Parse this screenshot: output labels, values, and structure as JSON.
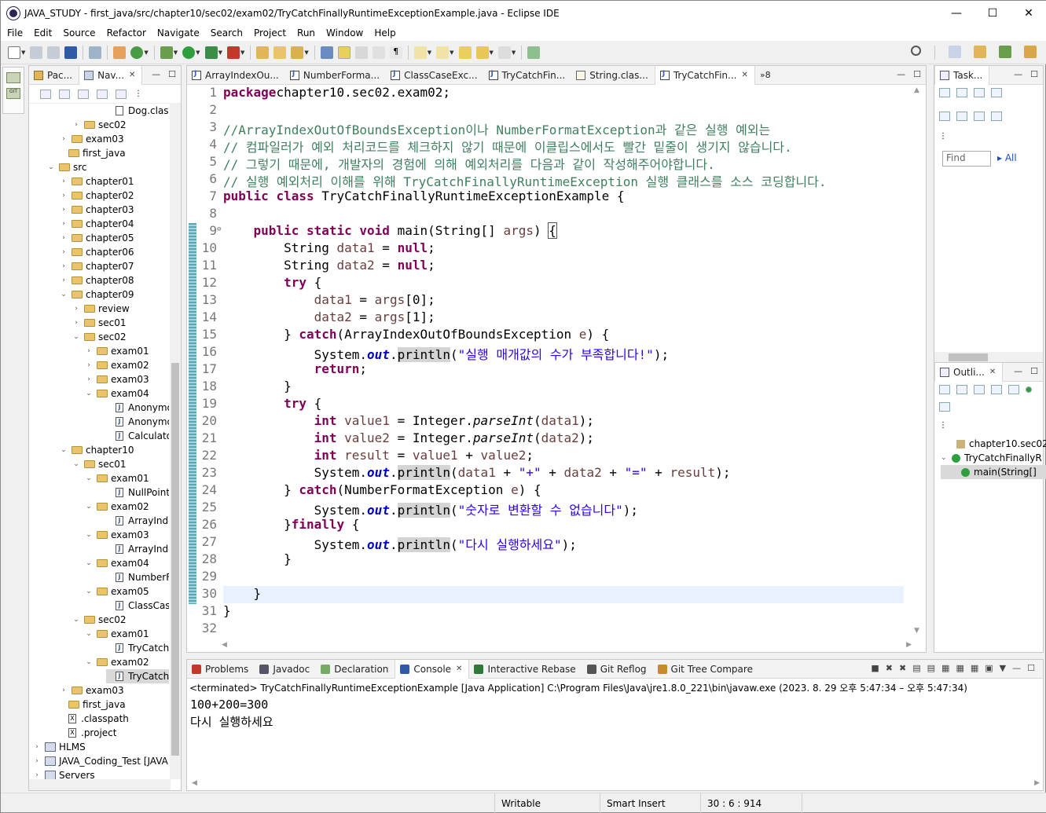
{
  "window": {
    "title": "JAVA_STUDY - first_java/src/chapter10/sec02/exam02/TryCatchFinallyRuntimeExceptionExample.java - Eclipse IDE",
    "controls": [
      "—",
      "☐",
      "✕"
    ]
  },
  "menu": [
    "File",
    "Edit",
    "Source",
    "Refactor",
    "Navigate",
    "Search",
    "Project",
    "Run",
    "Window",
    "Help"
  ],
  "explorer": {
    "tabs": [
      {
        "label": "Pac..."
      },
      {
        "label": "Nav..."
      }
    ],
    "items": [
      {
        "label": "Dog.class",
        "kind": "class",
        "depth": 6,
        "arrow": ""
      },
      {
        "label": "sec02",
        "kind": "folder",
        "depth": 3,
        "arrow": "›"
      },
      {
        "label": "exam03",
        "kind": "folder",
        "depth": 2,
        "arrow": "›"
      },
      {
        "label": "first_java",
        "kind": "folder",
        "depth": 2,
        "arrow": ""
      },
      {
        "label": "src",
        "kind": "folder",
        "depth": 1,
        "arrow": "⌄"
      },
      {
        "label": "chapter01",
        "kind": "folder",
        "depth": 2,
        "arrow": "›"
      },
      {
        "label": "chapter02",
        "kind": "folder",
        "depth": 2,
        "arrow": "›"
      },
      {
        "label": "chapter03",
        "kind": "folder",
        "depth": 2,
        "arrow": "›"
      },
      {
        "label": "chapter04",
        "kind": "folder",
        "depth": 2,
        "arrow": "›"
      },
      {
        "label": "chapter05",
        "kind": "folder",
        "depth": 2,
        "arrow": "›"
      },
      {
        "label": "chapter06",
        "kind": "folder",
        "depth": 2,
        "arrow": "›"
      },
      {
        "label": "chapter07",
        "kind": "folder",
        "depth": 2,
        "arrow": "›"
      },
      {
        "label": "chapter08",
        "kind": "folder",
        "depth": 2,
        "arrow": "›"
      },
      {
        "label": "chapter09",
        "kind": "folder",
        "depth": 2,
        "arrow": "⌄"
      },
      {
        "label": "review",
        "kind": "folder",
        "depth": 3,
        "arrow": "›"
      },
      {
        "label": "sec01",
        "kind": "folder",
        "depth": 3,
        "arrow": "›"
      },
      {
        "label": "sec02",
        "kind": "folder",
        "depth": 3,
        "arrow": "⌄"
      },
      {
        "label": "exam01",
        "kind": "folder",
        "depth": 4,
        "arrow": "›"
      },
      {
        "label": "exam02",
        "kind": "folder",
        "depth": 4,
        "arrow": "›"
      },
      {
        "label": "exam03",
        "kind": "folder",
        "depth": 4,
        "arrow": "›"
      },
      {
        "label": "exam04",
        "kind": "folder",
        "depth": 4,
        "arrow": "⌄"
      },
      {
        "label": "Anonymo",
        "kind": "java",
        "depth": 6,
        "arrow": ""
      },
      {
        "label": "Anonymo",
        "kind": "java",
        "depth": 6,
        "arrow": ""
      },
      {
        "label": "Calculator",
        "kind": "java",
        "depth": 6,
        "arrow": ""
      },
      {
        "label": "chapter10",
        "kind": "folder",
        "depth": 2,
        "arrow": "⌄"
      },
      {
        "label": "sec01",
        "kind": "folder",
        "depth": 3,
        "arrow": "⌄"
      },
      {
        "label": "exam01",
        "kind": "folder",
        "depth": 4,
        "arrow": "⌄"
      },
      {
        "label": "NullPointe",
        "kind": "java",
        "depth": 6,
        "arrow": ""
      },
      {
        "label": "exam02",
        "kind": "folder",
        "depth": 4,
        "arrow": "⌄"
      },
      {
        "label": "ArrayIndex",
        "kind": "java",
        "depth": 6,
        "arrow": ""
      },
      {
        "label": "exam03",
        "kind": "folder",
        "depth": 4,
        "arrow": "⌄"
      },
      {
        "label": "ArrayIndex",
        "kind": "java",
        "depth": 6,
        "arrow": ""
      },
      {
        "label": "exam04",
        "kind": "folder",
        "depth": 4,
        "arrow": "⌄"
      },
      {
        "label": "NumberFo",
        "kind": "java",
        "depth": 6,
        "arrow": ""
      },
      {
        "label": "exam05",
        "kind": "folder",
        "depth": 4,
        "arrow": "⌄"
      },
      {
        "label": "ClassCaseE",
        "kind": "java",
        "depth": 6,
        "arrow": ""
      },
      {
        "label": "sec02",
        "kind": "folder",
        "depth": 3,
        "arrow": "⌄"
      },
      {
        "label": "exam01",
        "kind": "folder",
        "depth": 4,
        "arrow": "⌄"
      },
      {
        "label": "TryCatchF",
        "kind": "java",
        "depth": 6,
        "arrow": ""
      },
      {
        "label": "exam02",
        "kind": "folder",
        "depth": 4,
        "arrow": "⌄"
      },
      {
        "label": "TryCatchF",
        "kind": "java",
        "depth": 6,
        "arrow": "",
        "selected": true
      },
      {
        "label": "exam03",
        "kind": "folder",
        "depth": 2,
        "arrow": "›"
      },
      {
        "label": "first_java",
        "kind": "folder",
        "depth": 2,
        "arrow": ""
      },
      {
        "label": ".classpath",
        "kind": "xml",
        "depth": 2,
        "arrow": ""
      },
      {
        "label": ".project",
        "kind": "xml",
        "depth": 2,
        "arrow": ""
      },
      {
        "label": "HLMS",
        "kind": "project",
        "depth": 0,
        "arrow": "›"
      },
      {
        "label": "JAVA_Coding_Test [JAVA",
        "kind": "project",
        "depth": 0,
        "arrow": "›"
      },
      {
        "label": "Servers",
        "kind": "project",
        "depth": 0,
        "arrow": "›"
      }
    ]
  },
  "editor": {
    "tabs": [
      {
        "label": "ArrayIndexOu...",
        "icon": "java"
      },
      {
        "label": "NumberForma...",
        "icon": "java"
      },
      {
        "label": "ClassCaseExc...",
        "icon": "java"
      },
      {
        "label": "TryCatchFin...",
        "icon": "java"
      },
      {
        "label": "String.clas...",
        "icon": "class"
      },
      {
        "label": "TryCatchFin...",
        "icon": "java",
        "active": true
      }
    ],
    "overflow": "»8",
    "current_line": 30,
    "lines": [
      [
        [
          "kw",
          "package"
        ],
        [
          "",
          "chapter10.sec02.exam02;"
        ]
      ],
      [],
      [
        [
          "cm",
          "//ArrayIndexOutOfBoundsException이나 NumberFormatException과 같은 실행 예외는"
        ]
      ],
      [
        [
          "cm",
          "// 컴파일러가 예외 처리코드를 체크하지 않기 때문에 이클립스에서도 빨간 밑줄이 생기지 않습니다."
        ]
      ],
      [
        [
          "cm",
          "// 그렇기 때문에, 개발자의 경험에 의해 예외처리를 다음과 같이 작성해주어야합니다."
        ]
      ],
      [
        [
          "cm",
          "// 실행 예외처리 이해를 위해 TryCatchFinallyRuntimeException 실행 클래스를 소스 코딩합니다."
        ]
      ],
      [
        [
          "kw",
          "public"
        ],
        [
          "",
          " "
        ],
        [
          "kw",
          "class"
        ],
        [
          "",
          " TryCatchFinallyRuntimeExceptionExample {"
        ]
      ],
      [],
      [
        [
          "",
          "    "
        ],
        [
          "kw",
          "public"
        ],
        [
          "",
          " "
        ],
        [
          "kw",
          "static"
        ],
        [
          "",
          " "
        ],
        [
          "kw",
          "void"
        ],
        [
          "",
          " main(String[] "
        ],
        [
          "pr",
          "args"
        ],
        [
          "",
          ") "
        ],
        [
          "brk",
          "{"
        ]
      ],
      [
        [
          "",
          "        String "
        ],
        [
          "pr",
          "data1"
        ],
        [
          "",
          " = "
        ],
        [
          "kw",
          "null"
        ],
        [
          "",
          ";"
        ]
      ],
      [
        [
          "",
          "        String "
        ],
        [
          "pr",
          "data2"
        ],
        [
          "",
          " = "
        ],
        [
          "kw",
          "null"
        ],
        [
          "",
          ";"
        ]
      ],
      [
        [
          "",
          "        "
        ],
        [
          "kw",
          "try"
        ],
        [
          "",
          " {"
        ]
      ],
      [
        [
          "",
          "            "
        ],
        [
          "pr",
          "data1"
        ],
        [
          "",
          " = "
        ],
        [
          "pr",
          "args"
        ],
        [
          "",
          "[0];"
        ]
      ],
      [
        [
          "",
          "            "
        ],
        [
          "pr",
          "data2"
        ],
        [
          "",
          " = "
        ],
        [
          "pr",
          "args"
        ],
        [
          "",
          "[1];"
        ]
      ],
      [
        [
          "",
          "        } "
        ],
        [
          "kw",
          "catch"
        ],
        [
          "",
          "(ArrayIndexOutOfBoundsException "
        ],
        [
          "pr",
          "e"
        ],
        [
          "",
          ") {"
        ]
      ],
      [
        [
          "",
          "            System."
        ],
        [
          "fld",
          "out"
        ],
        [
          "",
          "."
        ],
        [
          "hl",
          "println"
        ],
        [
          "",
          "("
        ],
        [
          "st",
          "\"실행 매개값의 수가 부족합니다!\""
        ],
        [
          "",
          ");"
        ]
      ],
      [
        [
          "",
          "            "
        ],
        [
          "kw",
          "return"
        ],
        [
          "",
          ";"
        ]
      ],
      [
        [
          "",
          "        }"
        ]
      ],
      [
        [
          "",
          "        "
        ],
        [
          "kw",
          "try"
        ],
        [
          "",
          " {"
        ]
      ],
      [
        [
          "",
          "            "
        ],
        [
          "kw",
          "int"
        ],
        [
          "",
          " "
        ],
        [
          "pr",
          "value1"
        ],
        [
          "",
          " = Integer."
        ],
        [
          "it",
          "parseInt"
        ],
        [
          "",
          "("
        ],
        [
          "pr",
          "data1"
        ],
        [
          "",
          ");"
        ]
      ],
      [
        [
          "",
          "            "
        ],
        [
          "kw",
          "int"
        ],
        [
          "",
          " "
        ],
        [
          "pr",
          "value2"
        ],
        [
          "",
          " = Integer."
        ],
        [
          "it",
          "parseInt"
        ],
        [
          "",
          "("
        ],
        [
          "pr",
          "data2"
        ],
        [
          "",
          ");"
        ]
      ],
      [
        [
          "",
          "            "
        ],
        [
          "kw",
          "int"
        ],
        [
          "",
          " "
        ],
        [
          "pr",
          "result"
        ],
        [
          "",
          " = "
        ],
        [
          "pr",
          "value1"
        ],
        [
          "",
          " + "
        ],
        [
          "pr",
          "value2"
        ],
        [
          "",
          ";"
        ]
      ],
      [
        [
          "",
          "            System."
        ],
        [
          "fld",
          "out"
        ],
        [
          "",
          "."
        ],
        [
          "hl",
          "println"
        ],
        [
          "",
          "("
        ],
        [
          "pr",
          "data1"
        ],
        [
          "",
          " + "
        ],
        [
          "st",
          "\"+\""
        ],
        [
          "",
          " + "
        ],
        [
          "pr",
          "data2"
        ],
        [
          "",
          " + "
        ],
        [
          "st",
          "\"=\""
        ],
        [
          "",
          " + "
        ],
        [
          "pr",
          "result"
        ],
        [
          "",
          ");"
        ]
      ],
      [
        [
          "",
          "        } "
        ],
        [
          "kw",
          "catch"
        ],
        [
          "",
          "(NumberFormatException "
        ],
        [
          "pr",
          "e"
        ],
        [
          "",
          ") {"
        ]
      ],
      [
        [
          "",
          "            System."
        ],
        [
          "fld",
          "out"
        ],
        [
          "",
          "."
        ],
        [
          "hl",
          "println"
        ],
        [
          "",
          "("
        ],
        [
          "st",
          "\"숫자로 변환할 수 없습니다\""
        ],
        [
          "",
          ");"
        ]
      ],
      [
        [
          "",
          "        }"
        ],
        [
          "kw",
          "finally"
        ],
        [
          "",
          " {"
        ]
      ],
      [
        [
          "",
          "            System."
        ],
        [
          "fld",
          "out"
        ],
        [
          "",
          "."
        ],
        [
          "hl",
          "println"
        ],
        [
          "",
          "("
        ],
        [
          "st",
          "\"다시 실행하세요\""
        ],
        [
          "",
          ");"
        ]
      ],
      [
        [
          "",
          "        }"
        ]
      ],
      [],
      [
        [
          "",
          "    }"
        ]
      ],
      [
        [
          "",
          "}"
        ]
      ],
      []
    ]
  },
  "tasks": {
    "tab": "Task...",
    "find_placeholder": "Find",
    "all_label": "All"
  },
  "outline": {
    "tab": "Outli...",
    "items": [
      {
        "label": "chapter10.sec02",
        "depth": 1
      },
      {
        "label": "TryCatchFinallyR",
        "depth": 0,
        "arrow": "⌄"
      },
      {
        "label": "main(String[]",
        "depth": 2,
        "selected": true
      }
    ]
  },
  "console": {
    "tabs": [
      {
        "label": "Problems"
      },
      {
        "label": "Javadoc"
      },
      {
        "label": "Declaration"
      },
      {
        "label": "Console",
        "active": true
      },
      {
        "label": "Interactive Rebase"
      },
      {
        "label": "Git Reflog"
      },
      {
        "label": "Git Tree Compare"
      }
    ],
    "description": "<terminated> TryCatchFinallyRuntimeExceptionExample [Java Application] C:\\Program Files\\Java\\jre1.8.0_221\\bin\\javaw.exe  (2023. 8. 29 오후 5:47:34 – 오후 5:47:34)",
    "output": [
      "100+200=300",
      "다시 실행하세요"
    ]
  },
  "status": {
    "writable": "Writable",
    "insert_mode": "Smart Insert",
    "position": "30 : 6 : 914"
  },
  "colors": {
    "keyword": "#7f0055",
    "comment": "#3f7f5f",
    "string": "#2a00ff",
    "field": "#0000c0",
    "folder": "#e9c46a",
    "selection": "#d9d9d9"
  }
}
